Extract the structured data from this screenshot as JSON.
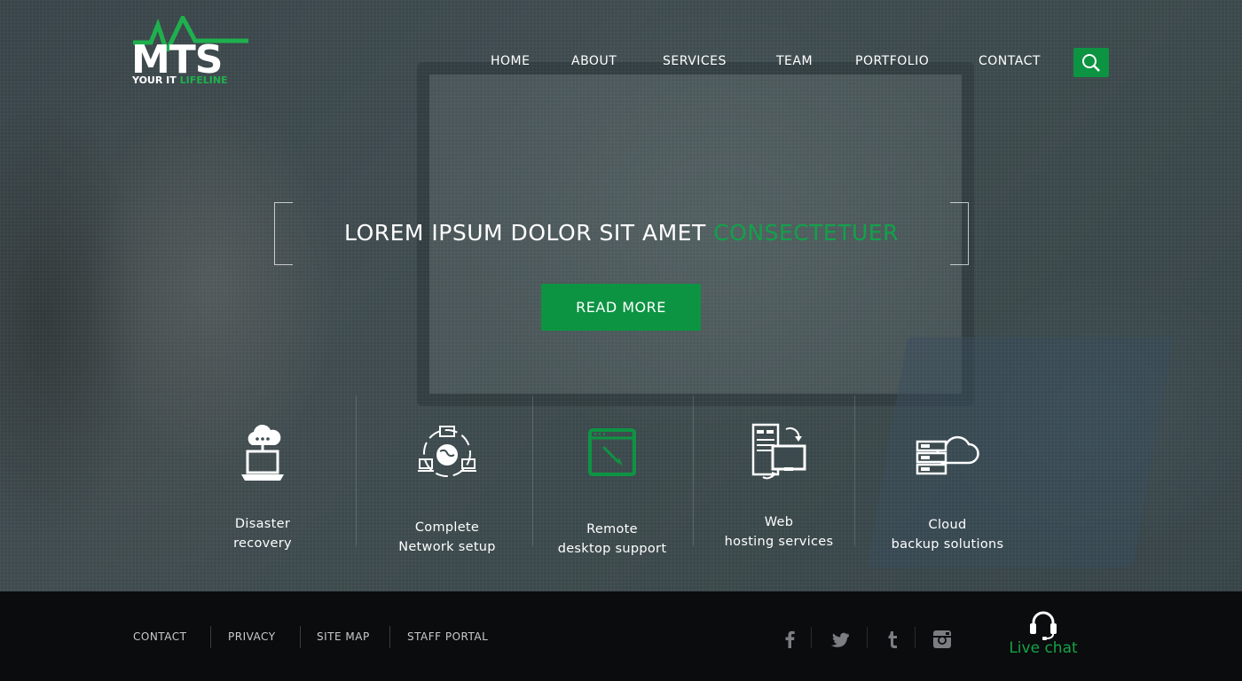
{
  "colors": {
    "accent": "#0d9443",
    "footer_bg": "#0b0c0d"
  },
  "logo": {
    "main": "MTS",
    "tagline_prefix": "YOUR IT",
    "tagline_highlight": "LIFELINE"
  },
  "nav": {
    "items": [
      {
        "label": "HOME"
      },
      {
        "label": "ABOUT"
      },
      {
        "label": "SERVICES"
      },
      {
        "label": "TEAM"
      },
      {
        "label": "PORTFOLIO"
      },
      {
        "label": "CONTACT"
      }
    ],
    "search_icon": "search-icon"
  },
  "hero": {
    "headline_white": "LOREM IPSUM DOLOR SIT AMET",
    "headline_green": "CONSECTETUER",
    "button_label": "READ MORE"
  },
  "services": [
    {
      "line1": "Disaster",
      "line2": "recovery",
      "icon": "cloud-computer-icon"
    },
    {
      "line1": "Complete",
      "line2": "Network setup",
      "icon": "network-globe-icon"
    },
    {
      "line1": "Remote",
      "line2": "desktop support",
      "icon": "remote-window-icon"
    },
    {
      "line1": "Web",
      "line2": "hosting services",
      "icon": "server-monitor-icon"
    },
    {
      "line1": "Cloud",
      "line2": "backup solutions",
      "icon": "cloud-server-icon"
    }
  ],
  "footer": {
    "links": [
      {
        "label": "CONTACT"
      },
      {
        "label": "PRIVACY"
      },
      {
        "label": "SITE MAP"
      },
      {
        "label": "STAFF PORTAL"
      }
    ],
    "social": [
      "facebook-icon",
      "twitter-icon",
      "tumblr-icon",
      "instagram-icon"
    ],
    "live_chat": "Live chat"
  }
}
